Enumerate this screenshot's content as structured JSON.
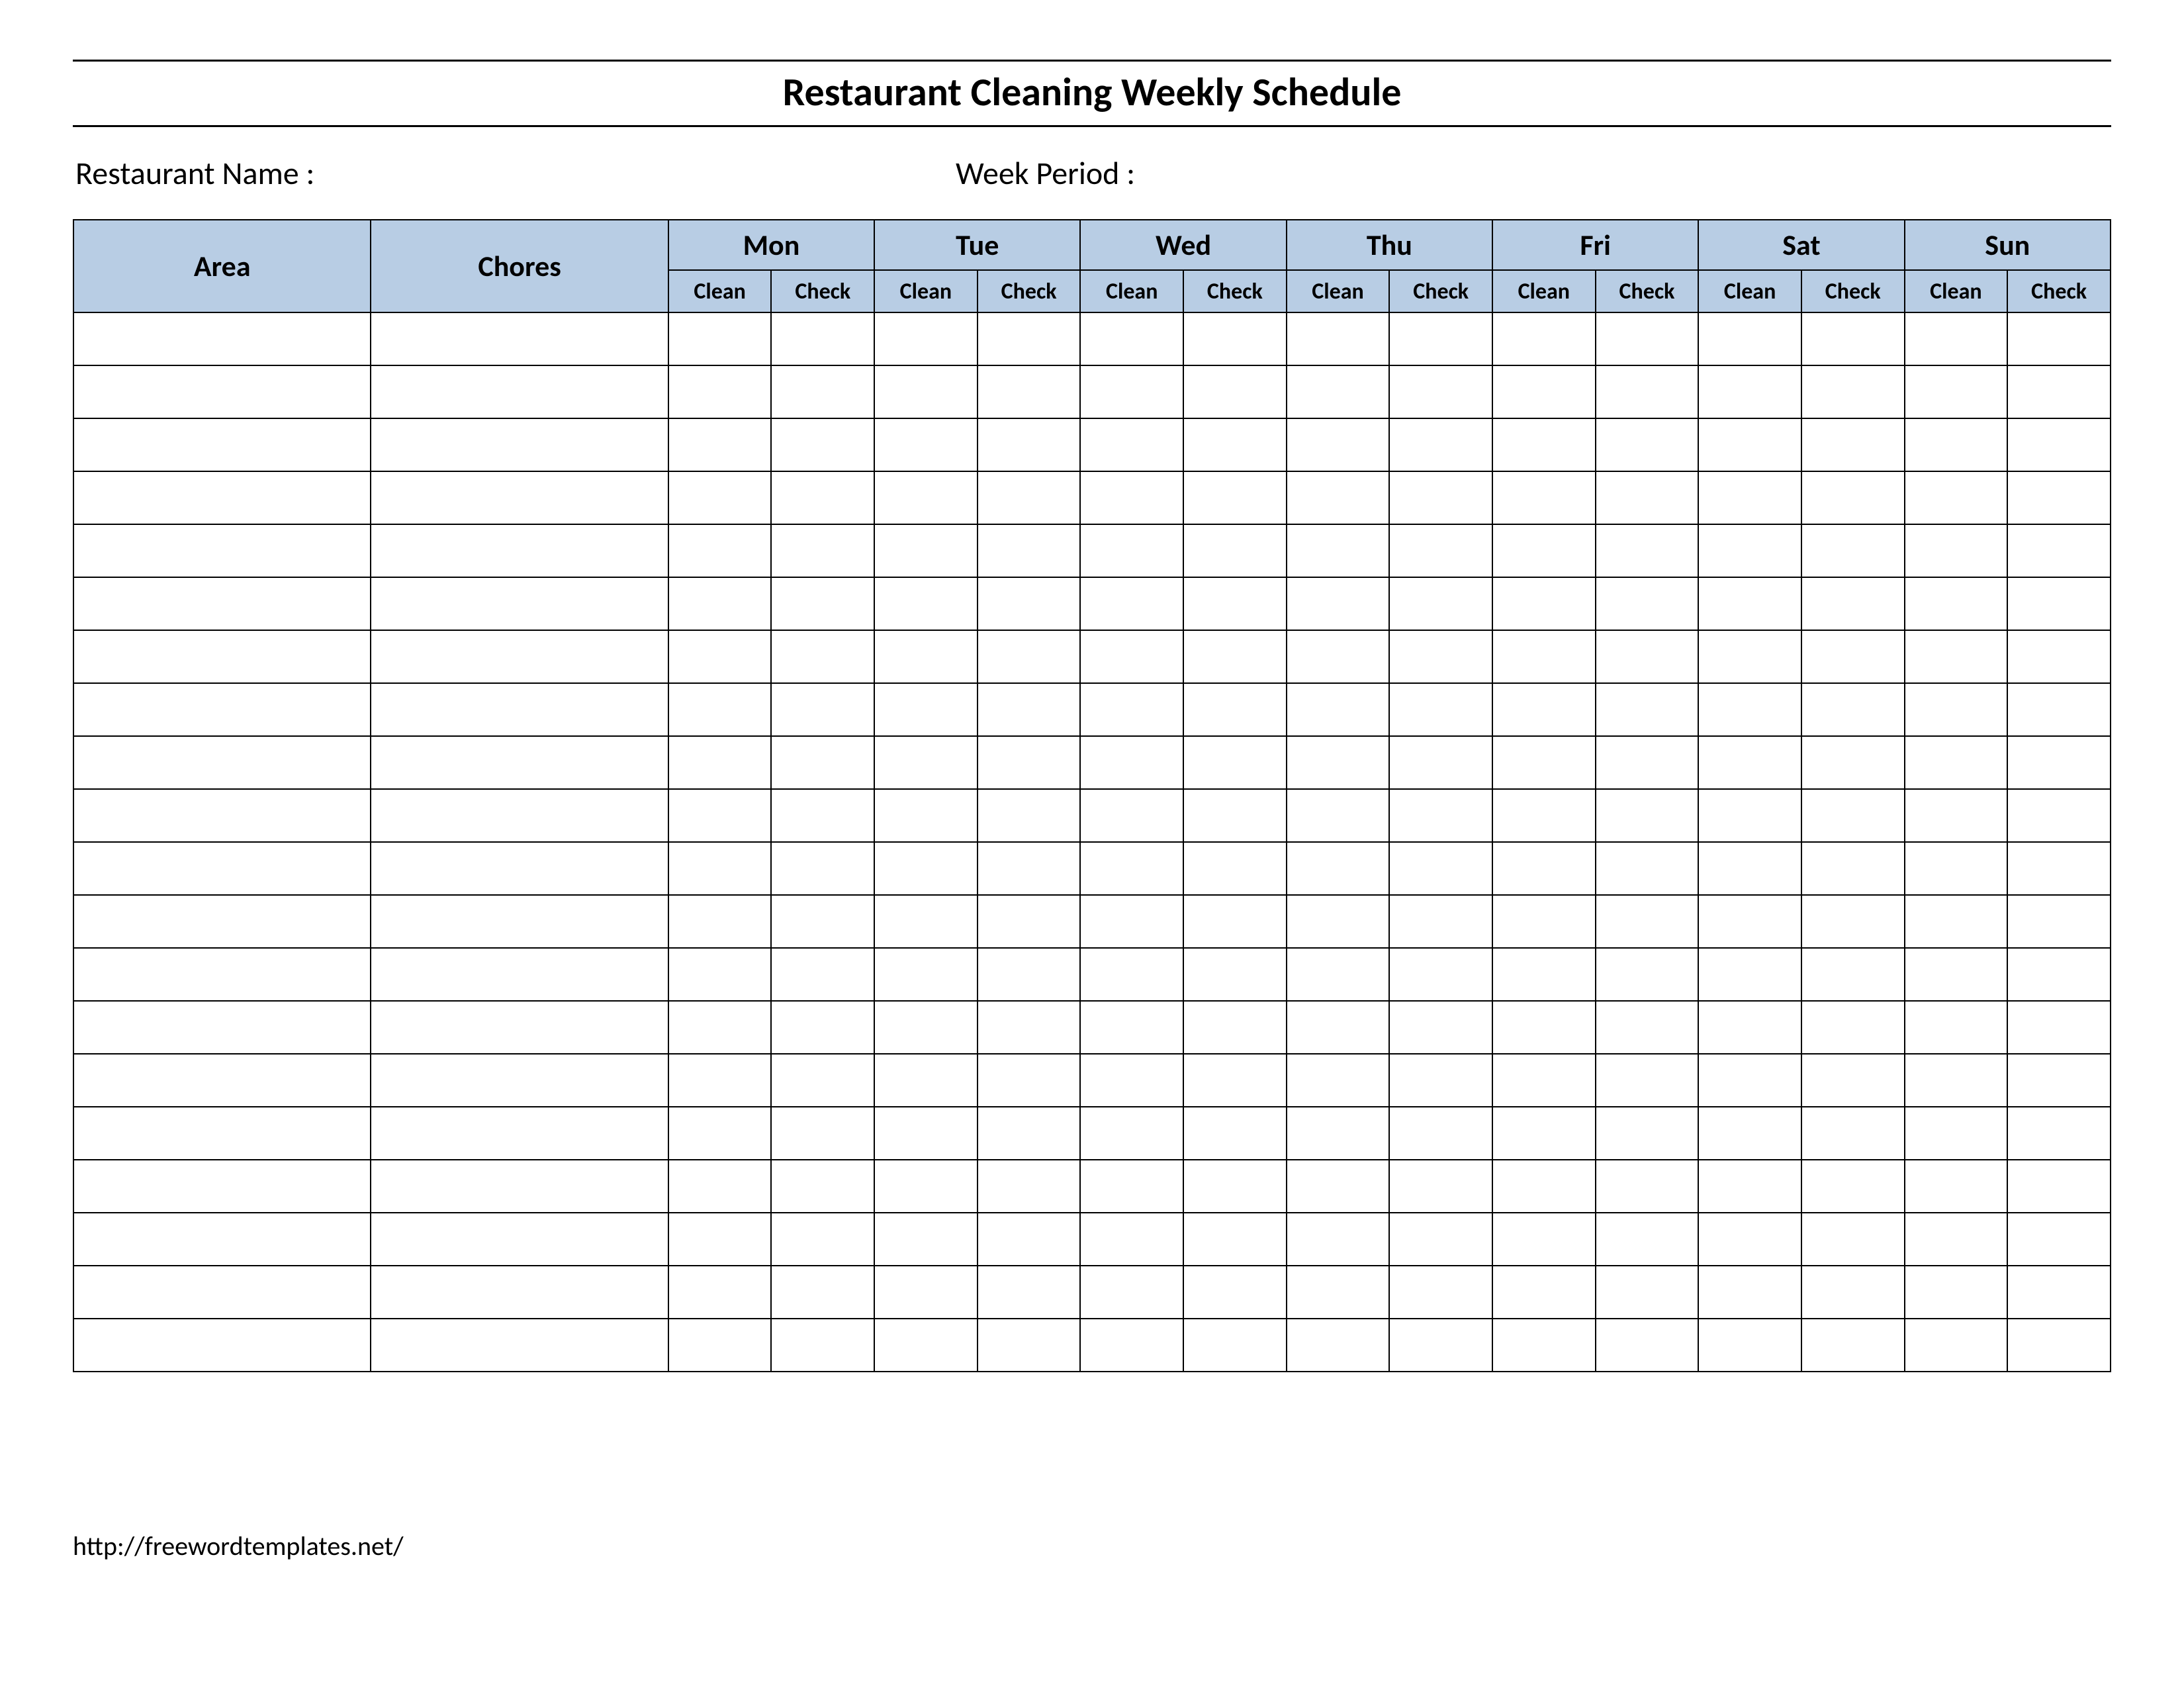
{
  "title": "Restaurant Cleaning Weekly Schedule",
  "meta": {
    "restaurant_name_label": "Restaurant Name   :",
    "week_period_label": "Week  Period :"
  },
  "headers": {
    "area": "Area",
    "chores": "Chores",
    "days": [
      "Mon",
      "Tue",
      "Wed",
      "Thu",
      "Fri",
      "Sat",
      "Sun"
    ],
    "sub_clean": "Clean",
    "sub_check": "Check"
  },
  "row_count": 20,
  "footer_url": "http://freewordtemplates.net/"
}
